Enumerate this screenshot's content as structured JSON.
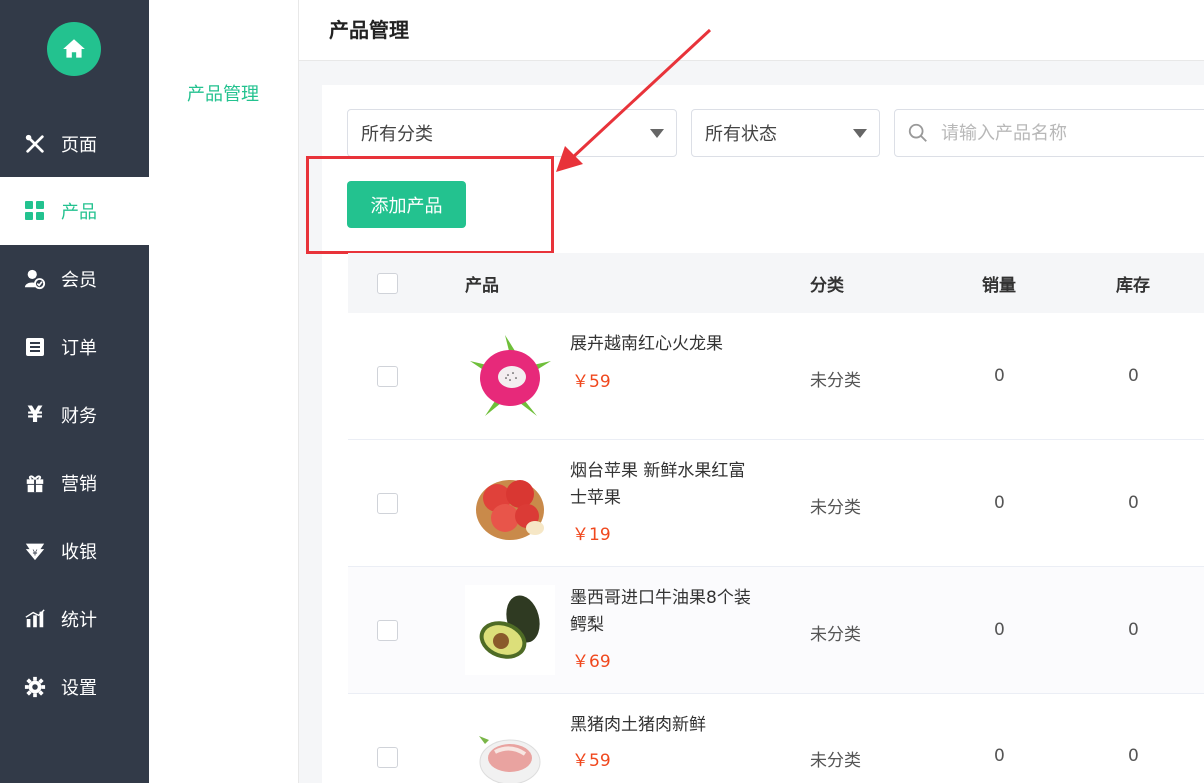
{
  "sidebar": {
    "items": [
      {
        "label": "页面",
        "icon": "tools-icon"
      },
      {
        "label": "产品",
        "icon": "grid-icon"
      },
      {
        "label": "会员",
        "icon": "member-icon"
      },
      {
        "label": "订单",
        "icon": "list-icon"
      },
      {
        "label": "财务",
        "icon": "yen-icon"
      },
      {
        "label": "营销",
        "icon": "gift-icon"
      },
      {
        "label": "收银",
        "icon": "cashier-icon"
      },
      {
        "label": "统计",
        "icon": "chart-icon"
      },
      {
        "label": "设置",
        "icon": "gear-icon"
      }
    ],
    "active_index": 1
  },
  "subnav": {
    "items": [
      {
        "label": "产品管理"
      }
    ]
  },
  "header": {
    "title": "产品管理"
  },
  "filters": {
    "category": {
      "value": "所有分类"
    },
    "status": {
      "value": "所有状态"
    },
    "search": {
      "placeholder": "请输入产品名称",
      "value": ""
    }
  },
  "toolbar": {
    "add_label": "添加产品"
  },
  "table": {
    "columns": {
      "product": "产品",
      "category": "分类",
      "sales": "销量",
      "stock": "库存"
    },
    "rows": [
      {
        "name": "展卉越南红心火龙果",
        "price": "￥59",
        "category": "未分类",
        "sales": "0",
        "stock": "0",
        "image": "dragonfruit"
      },
      {
        "name": "烟台苹果 新鲜水果红富士苹果",
        "price": "￥19",
        "category": "未分类",
        "sales": "0",
        "stock": "0",
        "image": "apple"
      },
      {
        "name": "墨西哥进口牛油果8个装鳄梨",
        "price": "￥69",
        "category": "未分类",
        "sales": "0",
        "stock": "0",
        "image": "avocado"
      },
      {
        "name": "黑猪肉土猪肉新鲜",
        "price": "￥59",
        "category": "未分类",
        "sales": "0",
        "stock": "0",
        "image": "pork"
      }
    ]
  },
  "colors": {
    "accent": "#23c28f",
    "sidebar_bg": "#323a48",
    "price": "#f0481e",
    "annotation": "#e8333a"
  }
}
